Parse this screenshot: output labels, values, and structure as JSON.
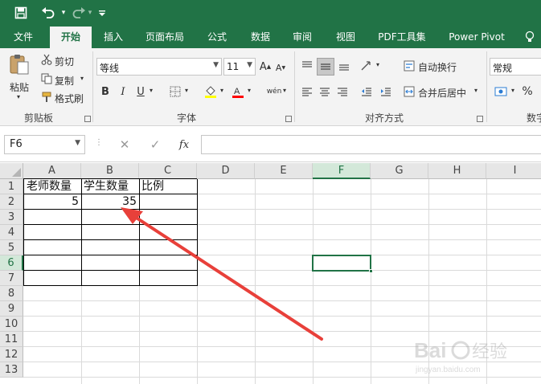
{
  "quick_access": {
    "save_icon": "save-icon",
    "undo_icon": "undo-icon",
    "redo_icon": "redo-icon",
    "customize_icon": "dropdown-icon"
  },
  "tabs": [
    {
      "label": "文件"
    },
    {
      "label": "开始"
    },
    {
      "label": "插入"
    },
    {
      "label": "页面布局"
    },
    {
      "label": "公式"
    },
    {
      "label": "数据"
    },
    {
      "label": "审阅"
    },
    {
      "label": "视图"
    },
    {
      "label": "PDF工具集"
    },
    {
      "label": "Power Pivot"
    }
  ],
  "ribbon": {
    "clipboard": {
      "paste": "粘贴",
      "cut": "剪切",
      "copy": "复制",
      "format_painter": "格式刷",
      "group": "剪贴板"
    },
    "font": {
      "name": "等线",
      "size": "11",
      "bold": "B",
      "italic": "I",
      "underline": "U",
      "phonetic": "wén",
      "group": "字体"
    },
    "alignment": {
      "wrap": "自动换行",
      "merge": "合并后居中",
      "group": "对齐方式"
    },
    "number": {
      "format": "常规",
      "percent": "%",
      "group": "数字"
    }
  },
  "formula_bar": {
    "name_box": "F6",
    "fx": "fx",
    "value": ""
  },
  "sheet": {
    "columns": [
      "A",
      "B",
      "C",
      "D",
      "E",
      "F",
      "G",
      "H",
      "I"
    ],
    "rows": [
      "1",
      "2",
      "3",
      "4",
      "5",
      "6",
      "7",
      "8",
      "9",
      "10",
      "11",
      "12",
      "13"
    ],
    "cells": {
      "A1": "老师数量",
      "B1": "学生数量",
      "C1": "比例",
      "A2": "5",
      "B2": "35"
    },
    "selected_cell": "F6"
  },
  "colors": {
    "excel_green": "#217346",
    "arrow_red": "#e8403a"
  }
}
